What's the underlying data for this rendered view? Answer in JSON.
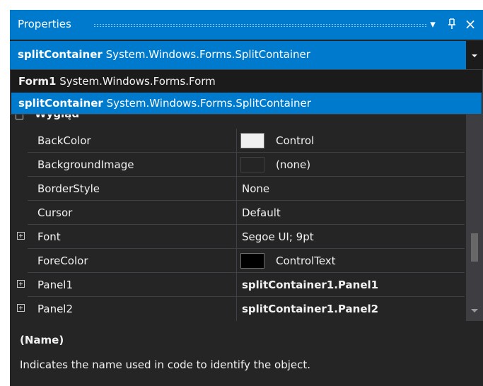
{
  "panel": {
    "title": "Properties",
    "dropdown_btn": "▾",
    "pin_btn": "ᚴ",
    "close_btn": "×"
  },
  "selector": {
    "object_name": "splitContainer",
    "object_type": "System.Windows.Forms.SplitContainer"
  },
  "dropdown": {
    "items": [
      {
        "name": "Form1",
        "type": "System.Windows.Forms.Form"
      },
      {
        "name": "splitContainer",
        "type": "System.Windows.Forms.SplitContainer"
      }
    ]
  },
  "grid": {
    "category_partial": "Wygląd",
    "rows": [
      {
        "name": "BackColor",
        "value": "Control",
        "swatch": "#f0f0f0"
      },
      {
        "name": "BackgroundImage",
        "value": "(none)",
        "swatch": "#252526"
      },
      {
        "name": "BorderStyle",
        "value": "None"
      },
      {
        "name": "Cursor",
        "value": "Default"
      },
      {
        "name": "Font",
        "value": "Segoe UI; 9pt"
      },
      {
        "name": "ForeColor",
        "value": "ControlText",
        "swatch": "#000000"
      },
      {
        "name": "Panel1",
        "value": "splitContainer1.Panel1"
      },
      {
        "name": "Panel2",
        "value": "splitContainer1.Panel2"
      }
    ]
  },
  "description": {
    "title": "(Name)",
    "text": "Indicates the name used in code to identify the object."
  },
  "colors": {
    "accent": "#007acc",
    "background": "#252526",
    "border": "#3f3f46"
  }
}
